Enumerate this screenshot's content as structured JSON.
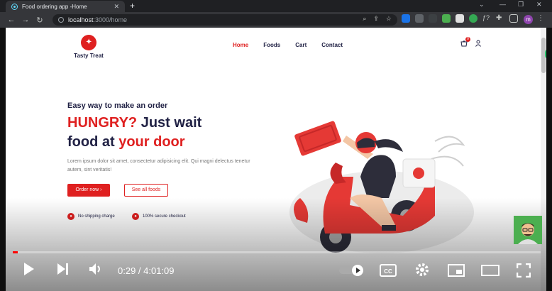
{
  "browser": {
    "tab_title": "Food ordering app -Home",
    "url_host": "localhost",
    "url_path": ":3000/home",
    "profile_initial": "m"
  },
  "site": {
    "brand": "Tasty Treat",
    "nav": [
      "Home",
      "Foods",
      "Cart",
      "Contact"
    ],
    "active_nav": "Home",
    "cart_count": "0"
  },
  "hero": {
    "eyebrow": "Easy way to make an order",
    "headline_part1": "HUNGRY?",
    "headline_part2": " Just wait",
    "headline_part3": "food at ",
    "headline_part4": "your door",
    "description": "Lorem ipsum dolor sit amet, consectetur adipisicing elit. Qui magni delectus tenetur autem, sint veritatis!",
    "order_button": "Order now ›",
    "foods_button": "See all foods",
    "feature1": "No shipping charge",
    "feature2": "100% secure checkout"
  },
  "player": {
    "time": "0:29 / 4:01:09",
    "progress": 0.002
  },
  "colors": {
    "accent": "#df2020",
    "heading": "#212245"
  }
}
